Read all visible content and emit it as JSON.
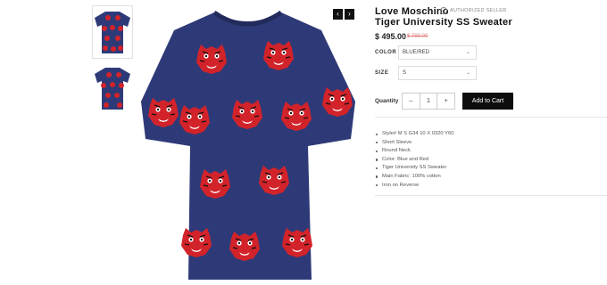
{
  "gallery": {
    "thumbnails": [
      "thumb-front",
      "thumb-back"
    ],
    "prev_icon": "‹",
    "next_icon": "›"
  },
  "product": {
    "brand": "Love Moschino",
    "authorized_label": "AUTHORIZED SELLER",
    "title": "Tiger University SS Sweater",
    "price": "$ 495.00",
    "old_price": "$ 790.00",
    "color": {
      "label": "COLOR",
      "value": "BLUE/RED"
    },
    "size": {
      "label": "SIZE",
      "value": "S"
    },
    "quantity": {
      "label": "Quantity",
      "minus": "–",
      "value": "1",
      "plus": "+"
    },
    "add_to_cart": "Add to Cart",
    "features": [
      "Style# M S G34 10 X 0320 Y60",
      "Short Sleeve",
      "Round Neck",
      "Color: Blue and Red",
      "Tiger University SS Sweater",
      "Main Fabric: 100% cotton",
      "Iron on Reverse"
    ]
  },
  "colors": {
    "shirt": "#2e3a78",
    "tiger": "#d2232a",
    "button": "#0d0d0d"
  }
}
